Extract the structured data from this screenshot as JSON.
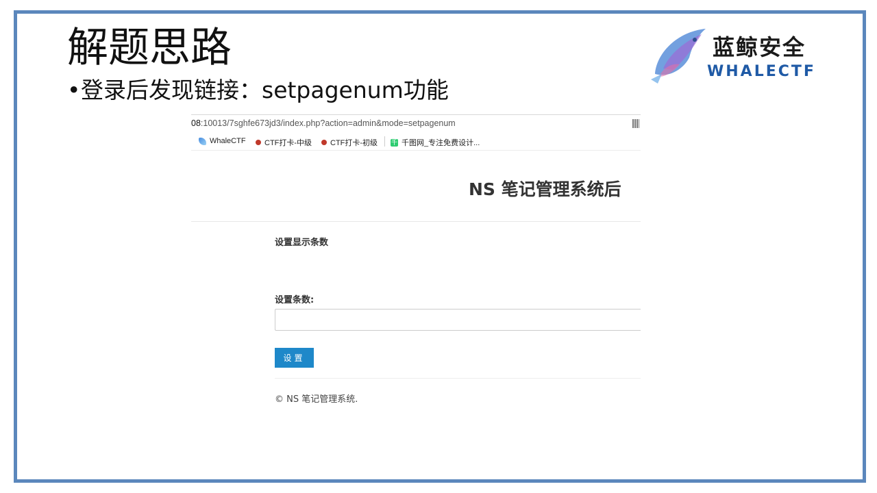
{
  "slide": {
    "title": "解题思路",
    "bullet": "登录后发现链接：setpagenum功能"
  },
  "logo": {
    "cn": "蓝鲸安全",
    "en": "WHALECTF"
  },
  "browser": {
    "url_host": "08",
    "url_rest": ":10013/7sghfe673jd3/index.php?action=admin&mode=setpagenum",
    "bookmarks": [
      {
        "label": "WhaleCTF",
        "icon": "whale-icon"
      },
      {
        "label": "CTF打卡-中级",
        "icon": "ctf-icon"
      },
      {
        "label": "CTF打卡-初级",
        "icon": "ctf-icon"
      },
      {
        "label": "千图网_专注免费设计...",
        "icon": "qiantu-icon"
      }
    ]
  },
  "page": {
    "heading": "NS 笔记管理系统后",
    "section_title": "设置显示条数",
    "field_label": "设置条数:",
    "field_value": "",
    "submit_label": "设置",
    "footer": "© NS 笔记管理系统."
  },
  "colors": {
    "frame": "#5b87bc",
    "button": "#1e88c9",
    "logo_en": "#1f5aa6"
  }
}
